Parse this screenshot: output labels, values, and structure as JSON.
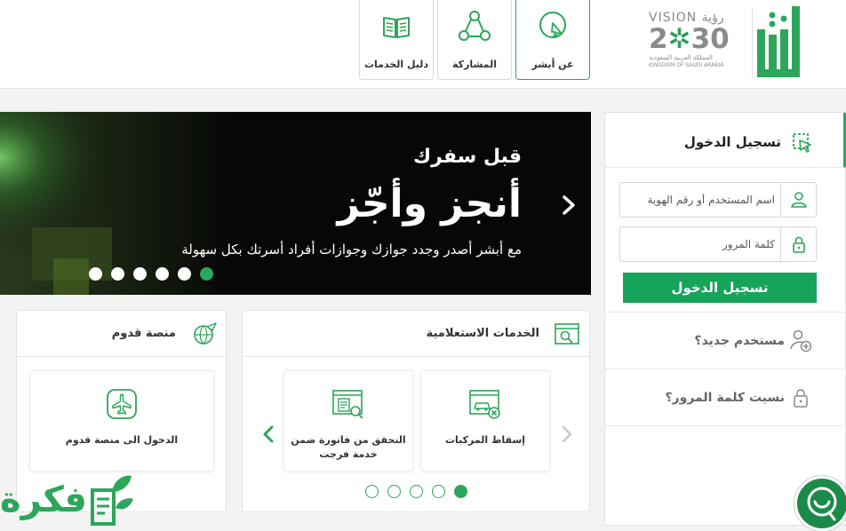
{
  "header": {
    "logo": {
      "absher_text": "أبشر",
      "vision_top": "VISION رؤية",
      "vision_year_a": "2",
      "vision_year_b": "30",
      "vision_sub_ar": "المملكة العربية السعودية",
      "vision_sub_en": "KINGDOM OF SAUDI ARABIA"
    },
    "nav": [
      {
        "label": "عن أبشر",
        "icon": "cursor-click-icon"
      },
      {
        "label": "المشاركة",
        "icon": "share-network-icon"
      },
      {
        "label": "دليل الخدمات",
        "icon": "open-book-icon"
      }
    ]
  },
  "hero": {
    "subtitle": "قبل سفرك",
    "title": "أنجز وأجّز",
    "description": "مع أبشر أصدر وجدد جوازك وجوازات أفراد أسرتك بكل سهولة",
    "slides_total": 6,
    "active_slide": 6
  },
  "login": {
    "title": "تسجيل الدخول",
    "username_placeholder": "اسم المستخدم أو رقم الهوية",
    "password_placeholder": "كلمة المرور",
    "button_label": "تسجيل الدخول",
    "new_user": "مستخدم جديد؟",
    "forgot_password": "نسيت كلمة المرور؟"
  },
  "inquiry": {
    "title": "الخدمات الاستعلامية",
    "services": [
      {
        "label": "إسقاط المركبات",
        "icon": "car-remove-icon"
      },
      {
        "label": "التحقق من فاتورة ضمن خدمة فرجت",
        "line1": "التحقق من فاتورة ضمن",
        "line2": "خدمة فرجت",
        "icon": "invoice-search-icon"
      }
    ],
    "pages_total": 5,
    "active_page": 5
  },
  "arrival": {
    "title": "منصة قدوم",
    "services": [
      {
        "label": "الدخول الى منصة قدوم",
        "icon": "airplane-icon"
      }
    ]
  },
  "watermark": {
    "text": "فكرة"
  },
  "colors": {
    "brand_green": "#2ca65a",
    "button_green": "#16a35a",
    "hero_bg": "#060806"
  }
}
